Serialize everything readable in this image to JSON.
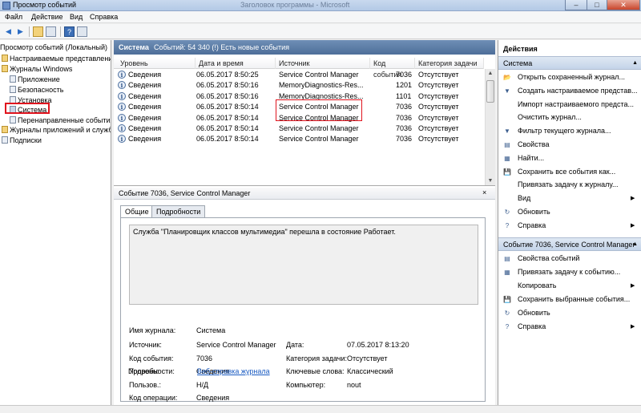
{
  "window": {
    "title": "Просмотр событий",
    "center_title": "Заголовок программы - Microsoft",
    "min": "–",
    "max": "□",
    "close": "✕"
  },
  "menu": {
    "file": "Файл",
    "action": "Действие",
    "view": "Вид",
    "help": "Справка"
  },
  "tree": {
    "root": "Просмотр событий (Локальный)",
    "custom_views": "Настраиваемые представления",
    "windows_logs": "Журналы Windows",
    "application": "Приложение",
    "security": "Безопасность",
    "setup": "Установка",
    "system": "Система",
    "forwarded": "Перенаправленные события",
    "app_services": "Журналы приложений и служб",
    "subscriptions": "Подписки"
  },
  "center": {
    "header_name": "Система",
    "header_info": "Событий: 54 340 (!) Есть новые события",
    "columns": [
      "Уровень",
      "Дата и время",
      "Источник",
      "Код события",
      "Категория задачи"
    ],
    "rows": [
      {
        "level": "Сведения",
        "date": "06.05.2017 8:50:25",
        "source": "Service Control Manager",
        "code": "7036",
        "category": "Отсутствует"
      },
      {
        "level": "Сведения",
        "date": "06.05.2017 8:50:16",
        "source": "MemoryDiagnostics-Res...",
        "code": "1201",
        "category": "Отсутствует"
      },
      {
        "level": "Сведения",
        "date": "06.05.2017 8:50:16",
        "source": "MemoryDiagnostics-Res...",
        "code": "1101",
        "category": "Отсутствует"
      },
      {
        "level": "Сведения",
        "date": "06.05.2017 8:50:14",
        "source": "Service Control Manager",
        "code": "7036",
        "category": "Отсутствует"
      },
      {
        "level": "Сведения",
        "date": "06.05.2017 8:50:14",
        "source": "Service Control Manager",
        "code": "7036",
        "category": "Отсутствует"
      },
      {
        "level": "Сведения",
        "date": "06.05.2017 8:50:14",
        "source": "Service Control Manager",
        "code": "7036",
        "category": "Отсутствует"
      },
      {
        "level": "Сведения",
        "date": "06.05.2017 8:50:14",
        "source": "Service Control Manager",
        "code": "7036",
        "category": "Отсутствует"
      }
    ],
    "detail_title": "Событие 7036, Service Control Manager",
    "detail_close": "×",
    "tab_general": "Общие",
    "tab_details": "Подробности",
    "message": "Служба \"Планировщик классов мультимедиа\" перешла в состояние Работает.",
    "props": {
      "log_name_label": "Имя журнала:",
      "log_name": "Система",
      "source_label": "Источник:",
      "source": "Service Control Manager",
      "date_label": "Дата:",
      "date": "07.05.2017 8:13:20",
      "code_label": "Код события:",
      "code": "7036",
      "task_label": "Категория задачи:",
      "task": "Отсутствует",
      "level_label": "Уровень:",
      "level": "Сведения",
      "keywords_label": "Ключевые слова:",
      "keywords": "Классический",
      "user_label": "Пользов.:",
      "user": "Н/Д",
      "computer_label": "Компьютер:",
      "computer": "nout",
      "opcode_label": "Код операции:",
      "opcode": "Сведения",
      "more_label": "Подробности:",
      "more_link": "Веб-справка журнала"
    }
  },
  "actions": {
    "title": "Действия",
    "section1": "Система",
    "items1": [
      "Открыть сохраненный журнал...",
      "Создать настраиваемое представ...",
      "Импорт настраиваемого предста...",
      "Очистить журнал...",
      "Фильтр текущего журнала...",
      "Свойства",
      "Найти...",
      "Сохранить все события как...",
      "Привязать задачу к журналу...",
      "Вид",
      "Обновить",
      "Справка"
    ],
    "section2": "Событие 7036, Service Control Manager",
    "items2": [
      "Свойства событий",
      "Привязать задачу к событию...",
      "Копировать",
      "Сохранить выбранные события...",
      "Обновить",
      "Справка"
    ]
  }
}
